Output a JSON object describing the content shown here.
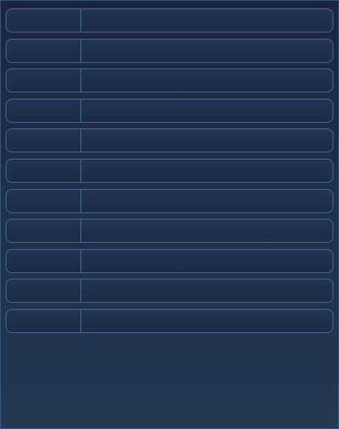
{
  "rows": [
    {
      "key": "",
      "value": ""
    },
    {
      "key": "",
      "value": ""
    },
    {
      "key": "",
      "value": ""
    },
    {
      "key": "",
      "value": ""
    },
    {
      "key": "",
      "value": ""
    },
    {
      "key": "",
      "value": ""
    },
    {
      "key": "",
      "value": ""
    },
    {
      "key": "",
      "value": ""
    },
    {
      "key": "",
      "value": ""
    },
    {
      "key": "",
      "value": ""
    },
    {
      "key": "",
      "value": ""
    }
  ],
  "colors": {
    "background_top": "#1b263d",
    "background_bottom": "#243851",
    "row_border": "#4a6ea8",
    "row_fill": "#1f3049"
  }
}
